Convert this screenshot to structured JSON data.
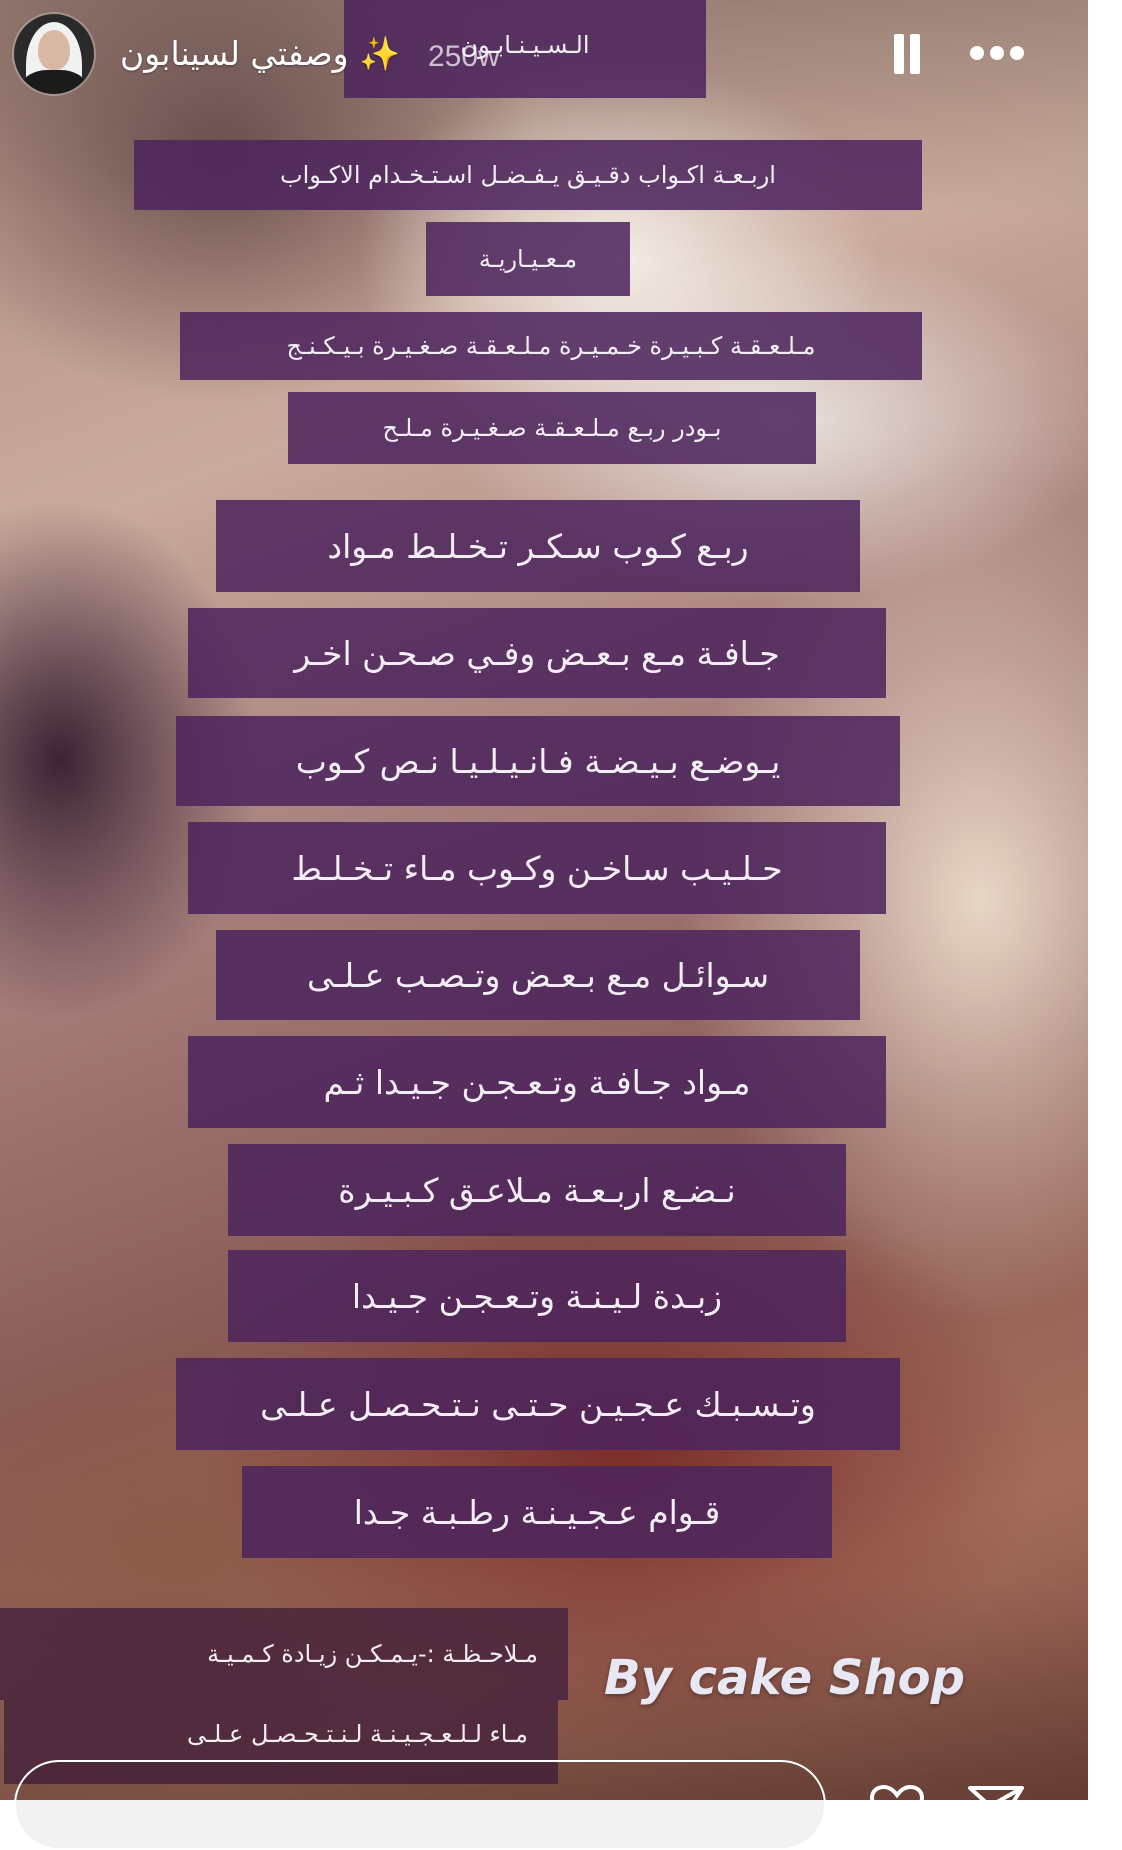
{
  "header": {
    "username": "وصفتي لسينابون ✨",
    "time_ago": "250w",
    "pause_icon": "pause-icon",
    "more_icon": "more-options-icon"
  },
  "story": {
    "title_text": "الـسـيـنـابـون",
    "lines": [
      "اربـعـة اكـواب دقـيـق يـفـضـل اسـتـخـدام الاكـواب",
      "مـعـيـاريـة",
      "مـلـعـقـة كـبـيـرة خـمـيـرة مـلـعـقـة صـغـيـرة بـيـكـنـج",
      "بـودر ربـع مـلـعـقـة صـغـيـرة مـلـح",
      "ربـع كـوب سـكـر تـخـلـط مـواد",
      "جـافـة مـع بـعـض وفـي صـحـن اخـر",
      "يـوضـع بـيـضـة فـانـيـلـيـا نـص كـوب",
      "حـلـيـب سـاخـن وكـوب مـاء تـخـلـط",
      "سـوائـل مـع بـعـض وتـصـب عـلـى",
      "مـواد جـافـة وتـعـجـن جـيـدا ثـم",
      "نـضـع اربـعـة مـلاعـق كـبـيـرة",
      "زبـدة لـيـنـة وتـعـجـن جـيـدا",
      "وتـسـبـك عـجـيـن حـتـى نـتـحـصـل عـلـى",
      "قـوام عـجـيـنـة رطـبـة جـدا"
    ],
    "note_lines": [
      "مـلاحـظـة :-يـمـكـن زيـادة كـمـيـة",
      "مـاء لـلـعـجـيـنـة لـنـتـحـصـل عـلـى"
    ],
    "watermark": "By cake Shop"
  },
  "footer": {
    "heart_icon": "heart-icon",
    "send_icon": "send-icon"
  },
  "colors": {
    "text_box_bg": "#4c245c",
    "text_color": "#f3eef5"
  }
}
